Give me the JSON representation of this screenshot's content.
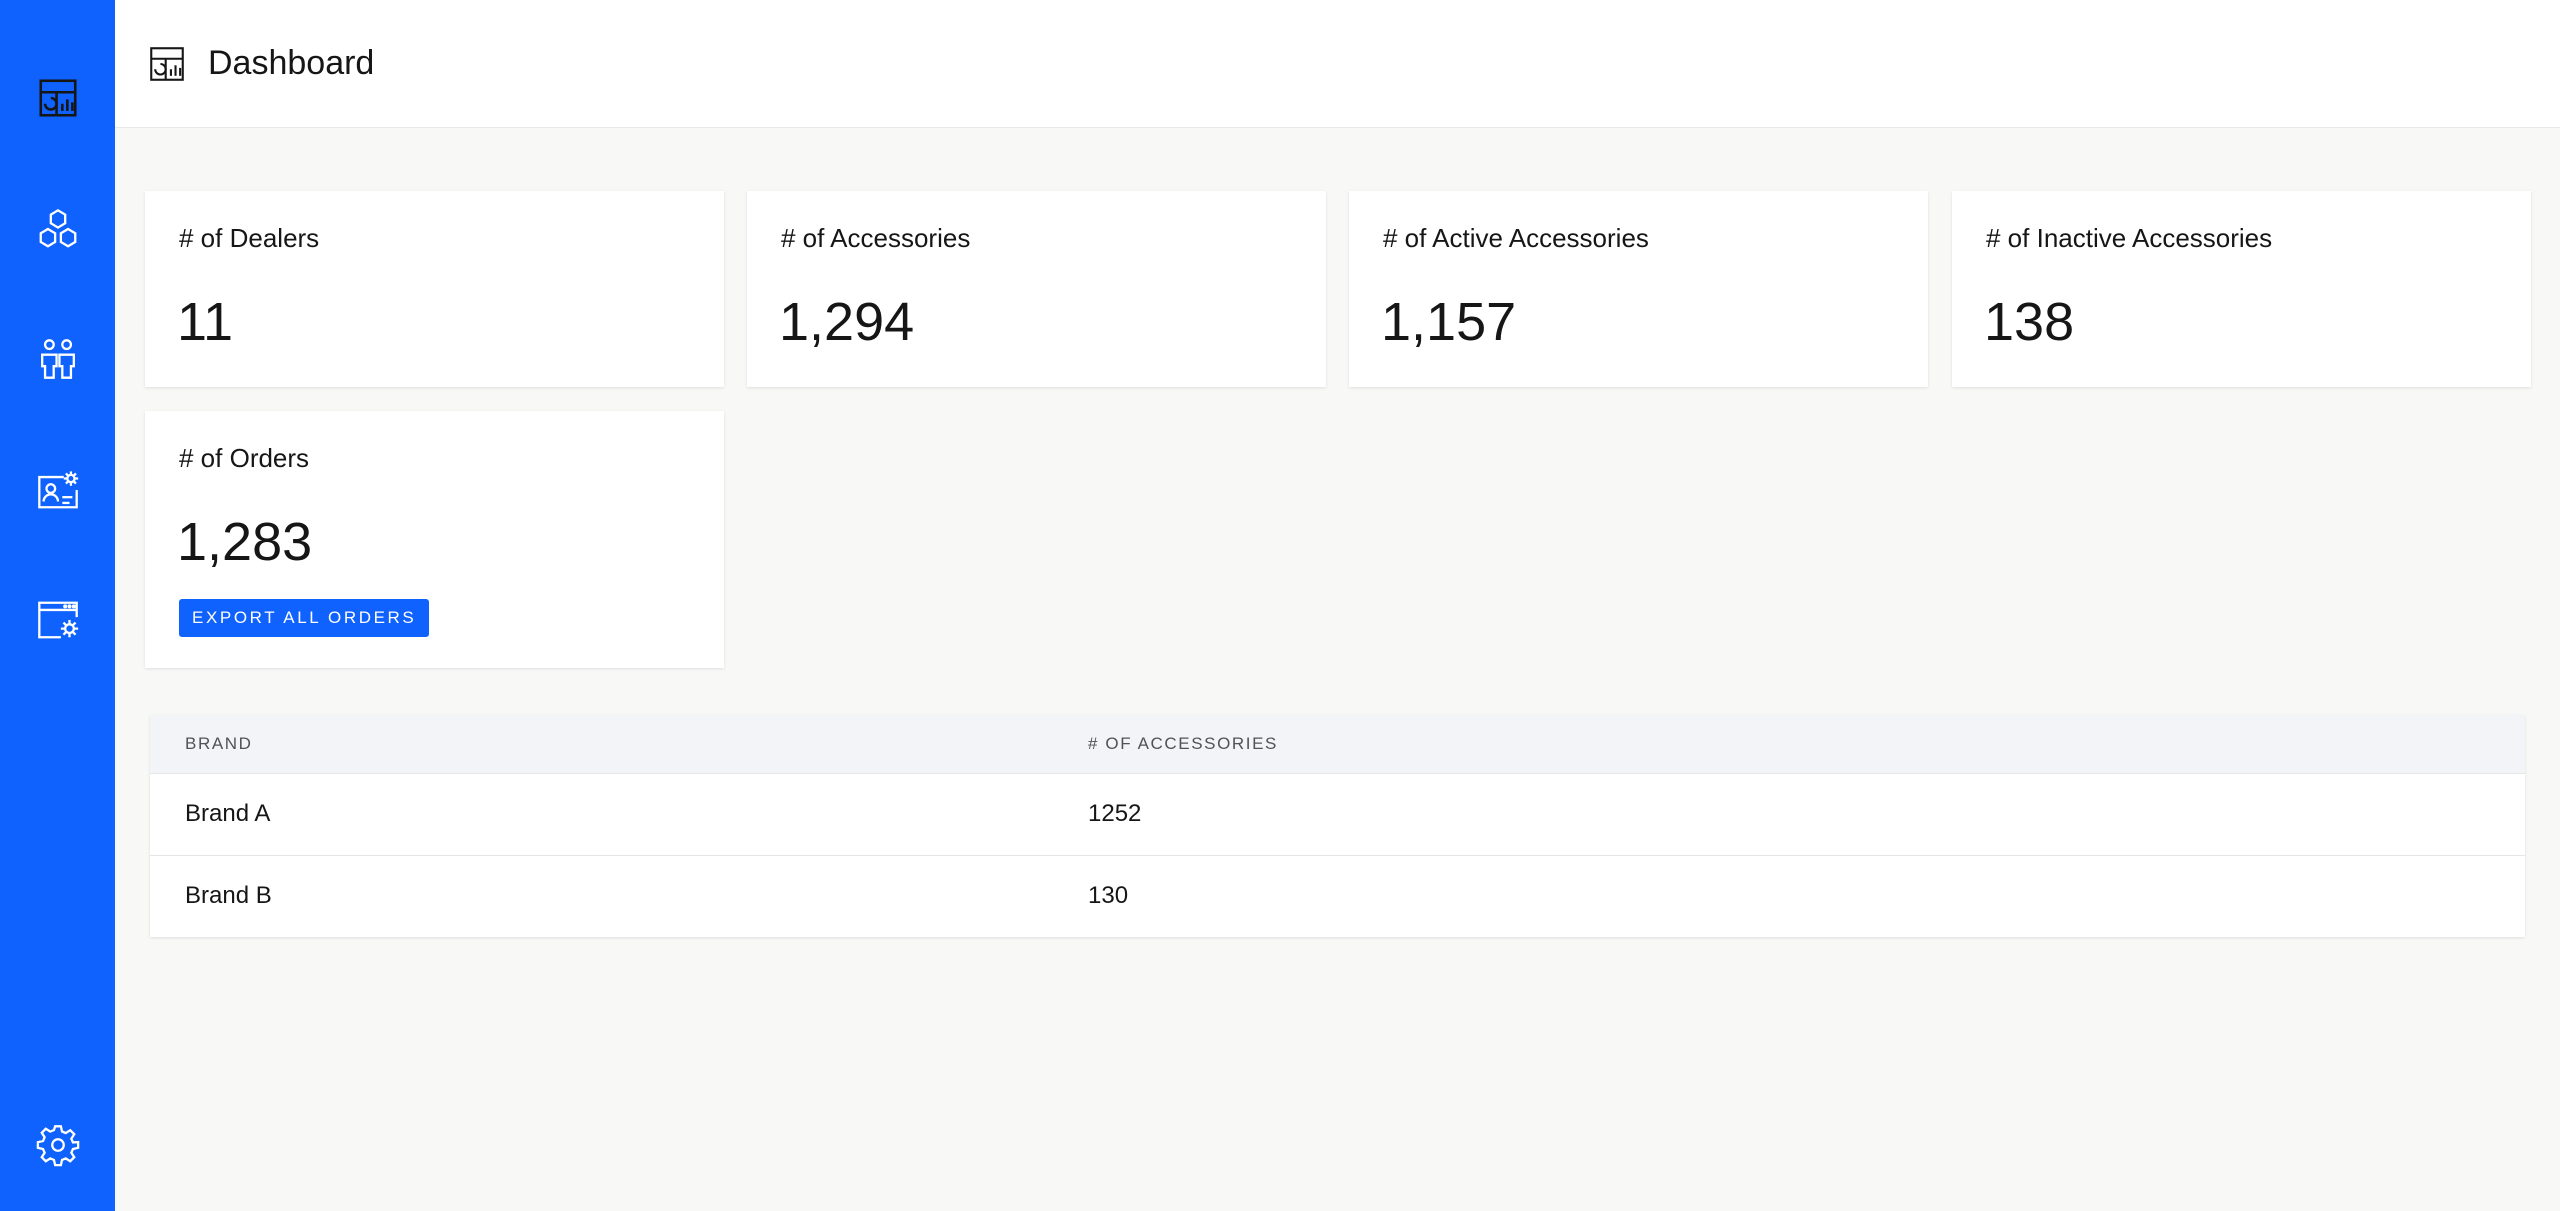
{
  "sidebar": {
    "items": [
      {
        "icon": "dashboard-icon"
      },
      {
        "icon": "hexagons-icon"
      },
      {
        "icon": "users-icon"
      },
      {
        "icon": "user-settings-icon"
      },
      {
        "icon": "app-settings-icon"
      }
    ],
    "footer_icon": "gear-icon",
    "background": "#0f62fe"
  },
  "header": {
    "title": "Dashboard",
    "icon": "dashboard-icon"
  },
  "stats": {
    "dealers": {
      "label": "# of Dealers",
      "value": "11"
    },
    "accessories": {
      "label": "# of Accessories",
      "value": "1,294"
    },
    "active_accessories": {
      "label": "# of Active Accessories",
      "value": "1,157"
    },
    "inactive_accessories": {
      "label": "# of Inactive Accessories",
      "value": "138"
    },
    "orders": {
      "label": "# of Orders",
      "value": "1,283",
      "button_label": "EXPORT ALL ORDERS"
    }
  },
  "brand_table": {
    "headers": [
      "BRAND",
      "# OF ACCESSORIES"
    ],
    "rows": [
      {
        "brand": "Brand A",
        "count": "1252"
      },
      {
        "brand": "Brand B",
        "count": "130"
      }
    ]
  },
  "colors": {
    "accent": "#0f62fe",
    "page_background": "#f8f8f7",
    "card_background": "#ffffff"
  }
}
